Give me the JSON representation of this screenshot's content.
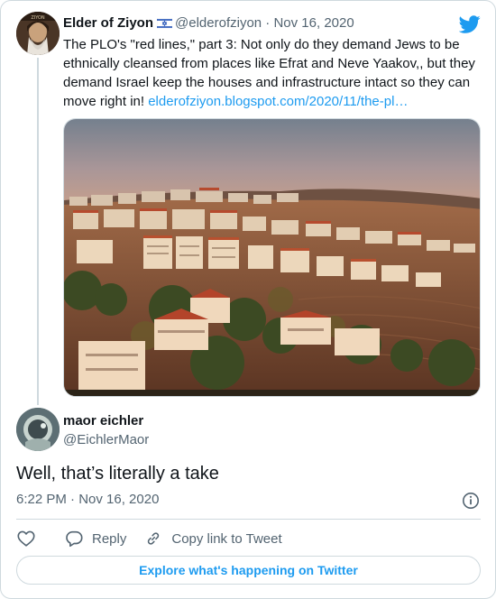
{
  "parent_tweet": {
    "author_name": "Elder of Ziyon",
    "author_handle": "@elderofziyon",
    "separator": "·",
    "date": "Nov 16, 2020",
    "flag_icon": "israel-flag-icon",
    "text": "The PLO's \"red lines,\" part 3: Not only do they demand Jews to be ethnically cleansed from places like Efrat and Neve Yaakov,, but they demand Israel keep the houses and infrastructure intact so they can move right in! ",
    "link_text": "elderofziyon.blogspot.com/2020/11/the-pl…"
  },
  "reply_tweet": {
    "author_name": "maor eichler",
    "author_handle": "@EichlerMaor",
    "text": "Well, that’s literally a take",
    "timestamp": "6:22 PM · Nov 16, 2020"
  },
  "actions": {
    "like_icon": "heart-icon",
    "reply_label": "Reply",
    "copy_label": "Copy link to Tweet"
  },
  "footer": {
    "explore_label": "Explore what's happening on Twitter"
  },
  "colors": {
    "accent": "#1d9bf0",
    "text": "#0f1419",
    "muted": "#536471",
    "border": "#cfd9de"
  }
}
